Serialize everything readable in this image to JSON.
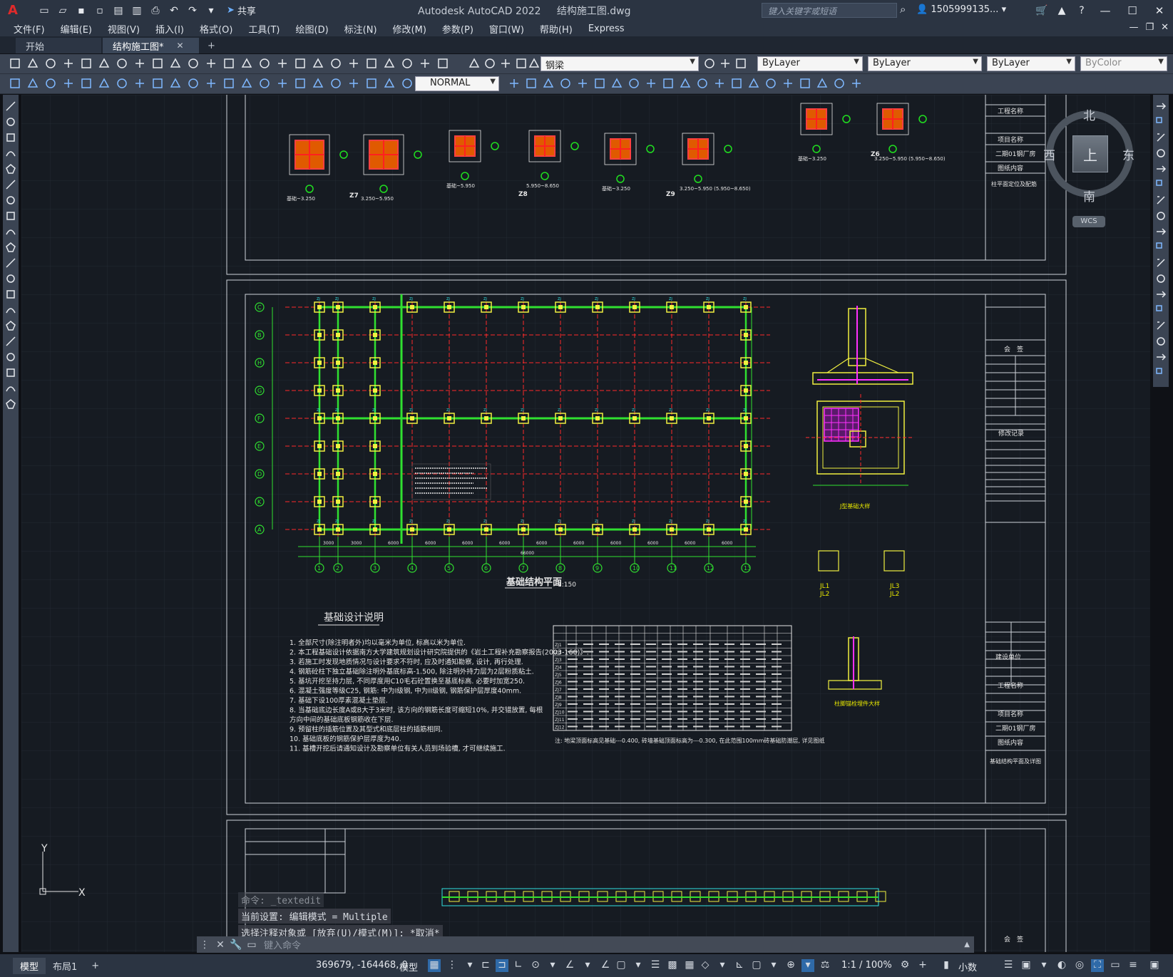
{
  "app": {
    "logo": "A",
    "title": "Autodesk AutoCAD 2022",
    "filename": "结构施工图.dwg",
    "share_label": "共享",
    "search_placeholder": "键入关键字或短语",
    "user": "1505999135...",
    "help": "?"
  },
  "menu": [
    "文件(F)",
    "编辑(E)",
    "视图(V)",
    "插入(I)",
    "格式(O)",
    "工具(T)",
    "绘图(D)",
    "标注(N)",
    "修改(M)",
    "参数(P)",
    "窗口(W)",
    "帮助(H)",
    "Express"
  ],
  "tabs": [
    {
      "label": "开始"
    },
    {
      "label": "结构施工图*",
      "active": true
    }
  ],
  "toolbar": {
    "layer": "钢梁",
    "color": "ByLayer",
    "linetype": "ByLayer",
    "lineweight": "ByLayer",
    "plotstyle": "ByColor",
    "dimstyle": "NORMAL"
  },
  "viewcube": {
    "north": "北",
    "south": "南",
    "east": "东",
    "west": "西",
    "face": "上",
    "wcs": "WCS"
  },
  "ucs": {
    "x": "X",
    "y": "Y"
  },
  "drawing": {
    "sheet_title": "基础结构平面",
    "sheet_scale": "1:150",
    "notes_title": "基础设计说明",
    "notes": [
      "1. 全部尺寸(除注明者外)均以毫米为单位, 标高以米为单位.",
      "2. 本工程基础设计依据南方大学建筑规划设计研究院提供的《岩土工程补充勘察报告(2003-160)》.",
      "3. 若施工时发现地质情况与设计要求不符时, 应及时通知勘察, 设计, 再行处理.",
      "4. 钢筋砼柱下独立基础除注明外基底标高-1.500, 除注明外持力层为2层粉质粘土.",
      "5. 基坑开挖至持力层, 不同厚度用C10毛石砼置换至基底标高. 必要时加宽250.",
      "6. 混凝土强度等级C25, 钢筋: 中为I级钢, 中为II级钢, 钢筋保护层厚度40mm.",
      "7. 基础下设100厚素混凝土垫层.",
      "8. 当基础底边长度A或B大于3米时, 该方向的钢筋长度可缩短10%, 并交错放置, 每根",
      "   方向中间的基础底板钢筋收在下层.",
      "9. 预留柱的插筋位置及其型式和底层柱的插筋相同.",
      "10. 基础底板的钢筋保护层厚度为40.",
      "11. 基槽开挖后请通知设计及勘察单位有关人员到场验槽, 才可继续施工."
    ],
    "grid_cols": [
      "1",
      "2",
      "3",
      "4",
      "5",
      "6",
      "7",
      "8",
      "9",
      "10",
      "11",
      "12",
      "13"
    ],
    "grid_rows": [
      "C",
      "B",
      "H",
      "G",
      "F",
      "E",
      "D",
      "K",
      "A"
    ],
    "dims_bottom": [
      "3000",
      "3000",
      "6000",
      "6000",
      "6000",
      "6000",
      "6000",
      "6000",
      "6000",
      "6000",
      "6000",
      "6000"
    ],
    "dims_total": "66000",
    "col_labels_top": [
      "Z7",
      "Z8",
      "Z9",
      "Z6"
    ],
    "col_elev": [
      "基础~3.250",
      "3.250~5.950",
      "基础~5.950",
      "5.950~8.650",
      "基础~3.250",
      "3.250~5.950 (5.950~8.650)",
      "基础~3.250",
      "3.250~5.950 (5.950~8.650)"
    ],
    "title_block": {
      "project_label": "工程名称",
      "item_label": "项目名称",
      "item_value": "二期01钢厂房",
      "drawing_label": "图纸内容",
      "drawing_value_top": "柱平面定位及配筋",
      "drawing_value_mid": "基础结构平面及详图",
      "sign_label": "会　签",
      "revision_label": "修改记录",
      "build_unit": "建设单位"
    },
    "detail_label_1": "J型基础大样",
    "detail_label_2": "柱脚锚栓埋件大样",
    "detail_jl1": "JL1",
    "detail_jl2": "JL2",
    "detail_jl3": "JL3",
    "table_note": "注: 地梁顶面标高见基础---0.400, 砖墙基础顶面标高为---0.300, 在此范围100mm砖基础防潮层, 详见图纸",
    "table_rows": [
      "ZJ1",
      "ZJ2",
      "ZJ3",
      "ZJ4",
      "ZJ5",
      "ZJ6",
      "ZJ7",
      "ZJ8",
      "ZJ9",
      "ZJ10",
      "ZJ11",
      "ZJ12"
    ]
  },
  "command": {
    "history": [
      "命令: _textedit",
      "当前设置: 编辑模式 = Multiple",
      "选择注释对象或 [放弃(U)/模式(M)]: *取消*"
    ],
    "placeholder": "键入命令"
  },
  "status": {
    "layout_tabs": [
      "模型",
      "布局1"
    ],
    "coords": "369679, -164468, 0",
    "model": "模型",
    "scale": "1:1 / 100%",
    "units": "小数"
  }
}
